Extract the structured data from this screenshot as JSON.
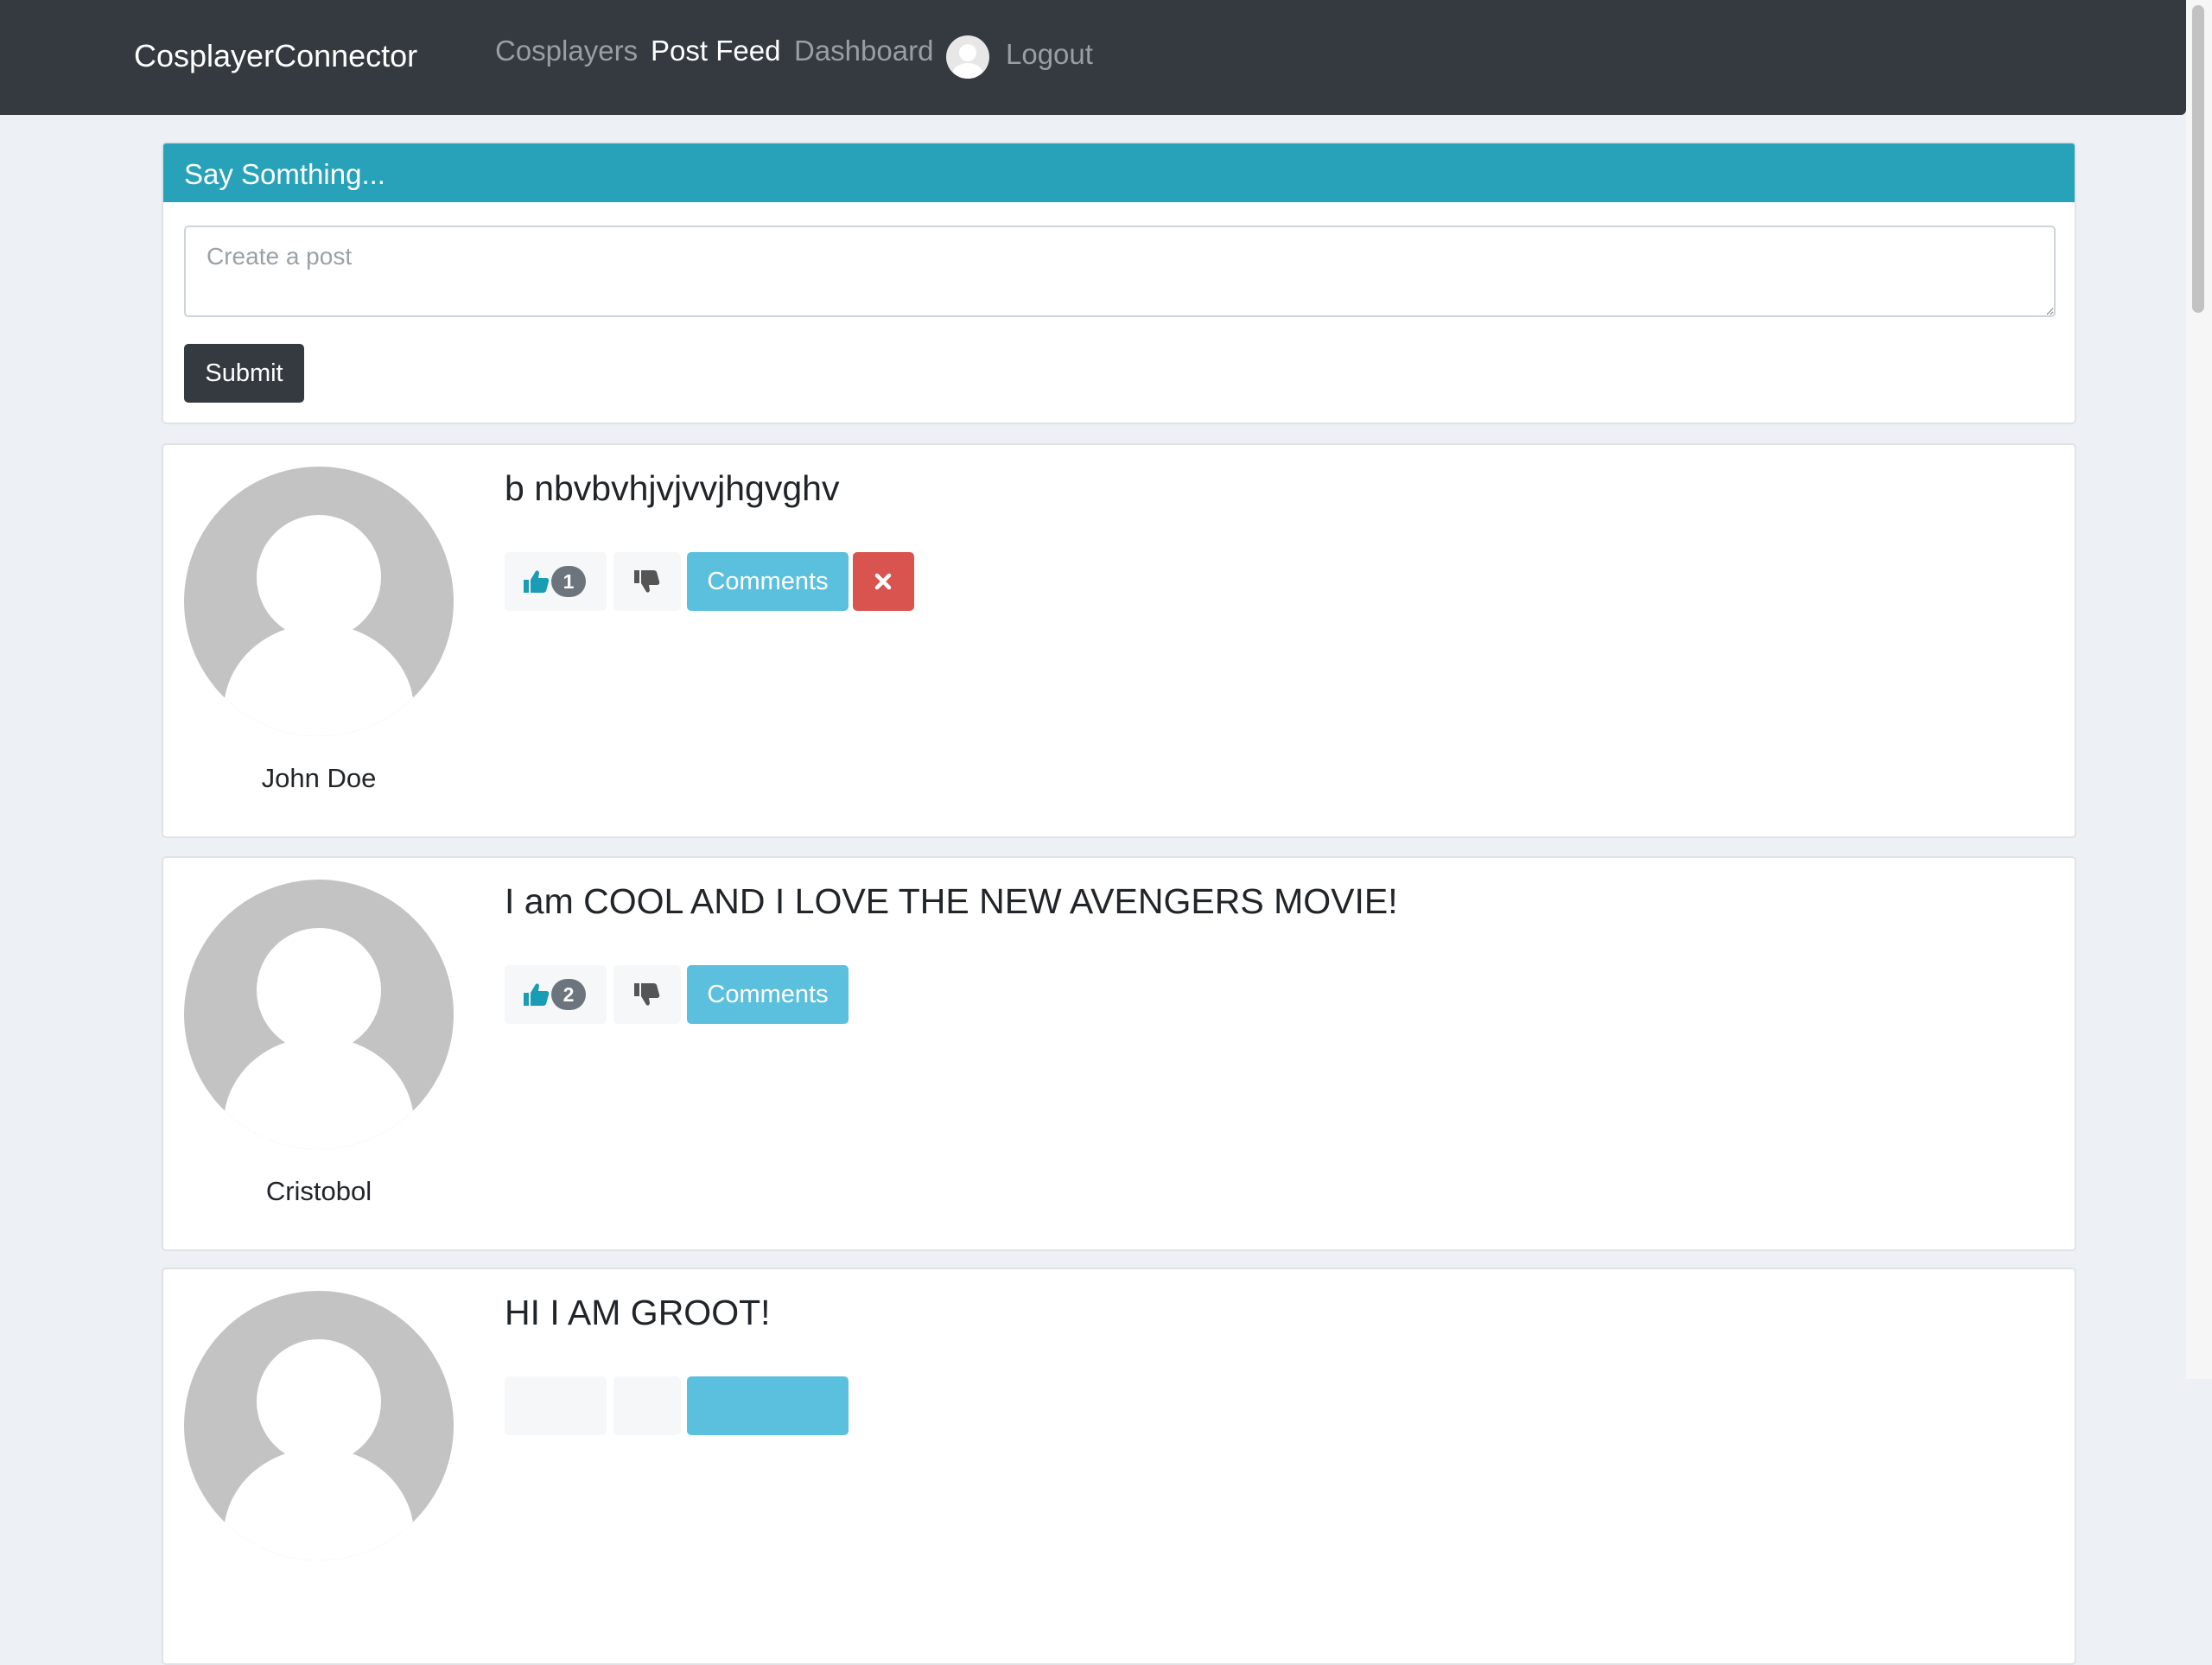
{
  "navbar": {
    "brand": "CosplayerConnector",
    "links": [
      "Cosplayers",
      "Post Feed",
      "Dashboard"
    ],
    "logout": "Logout"
  },
  "composer": {
    "header": "Say Somthing...",
    "placeholder": "Create a post",
    "submit_label": "Submit"
  },
  "posts": [
    {
      "author": "John Doe",
      "text": "b nbvbvhjvjvvjhgvghv",
      "likes": "1",
      "comments_label": "Comments",
      "deletable": true
    },
    {
      "author": "Cristobol",
      "text": "I am COOL AND I LOVE THE NEW AVENGERS MOVIE!",
      "likes": "2",
      "comments_label": "Comments",
      "deletable": false
    },
    {
      "author": "",
      "text": "HI I AM GROOT!",
      "likes": "",
      "comments_label": "",
      "deletable": false
    }
  ],
  "icons": {
    "like": "thumbs-up-icon",
    "dislike": "thumbs-down-icon",
    "delete": "close-icon",
    "avatar": "user-avatar-icon"
  },
  "colors": {
    "navbar_bg": "#343a40",
    "composer_header": "#27a2b9",
    "like_icon": "#1b9cb5",
    "comments_button": "#5bc0de",
    "delete_button": "#d9534f",
    "submit_button": "#343a40"
  }
}
